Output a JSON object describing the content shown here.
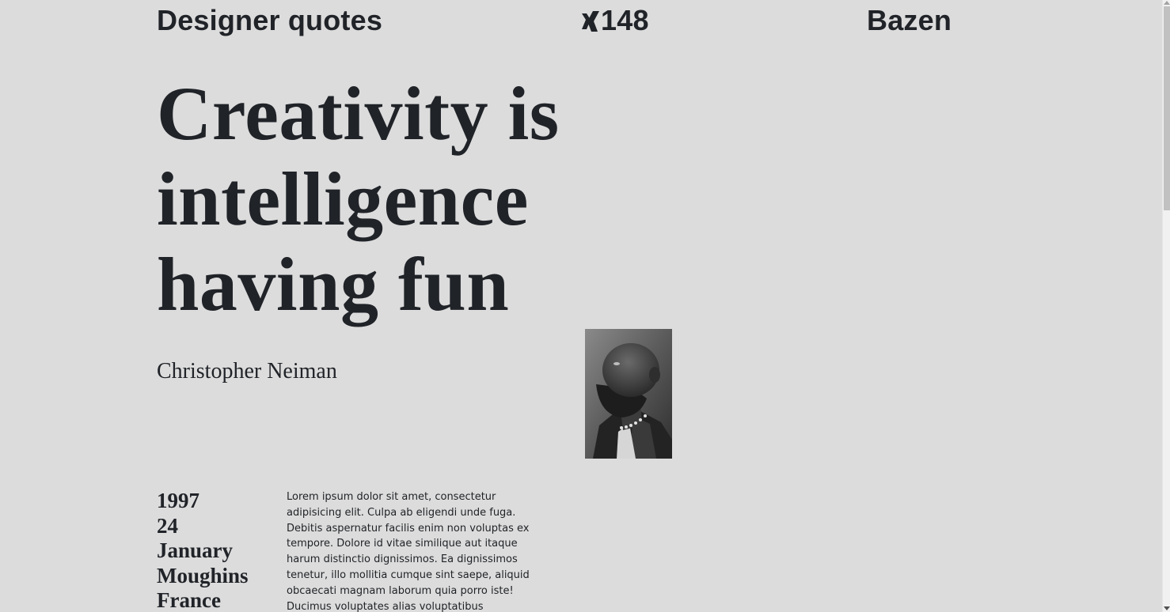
{
  "header": {
    "left_label": "Designer quotes",
    "center_icon": "xing-logo-icon",
    "center_number": "148",
    "right_label": "Bazen"
  },
  "quote": {
    "lines": [
      "Creativity is",
      "intelligence",
      "having fun"
    ],
    "author": "Christopher Neiman"
  },
  "portrait": {
    "alt": "Black and white portrait of a bearded man looking upward"
  },
  "facts": [
    "1997",
    "24",
    "January",
    "Moughins",
    "France"
  ],
  "body_text": "Lorem ipsum dolor sit amet, consectetur adipisicing elit. Culpa ab eligendi unde fuga. Debitis aspernatur facilis enim non voluptas ex tempore. Dolore id vitae similique aut itaque harum distinctio dignissimos. Ea dignissimos tenetur, illo mollitia cumque sint saepe, aliquid obcaecati magnam laborum quia porro iste! Ducimus voluptates alias voluptatibus molestiae?",
  "colors": {
    "background": "#dcdcdc",
    "text": "#202328"
  }
}
